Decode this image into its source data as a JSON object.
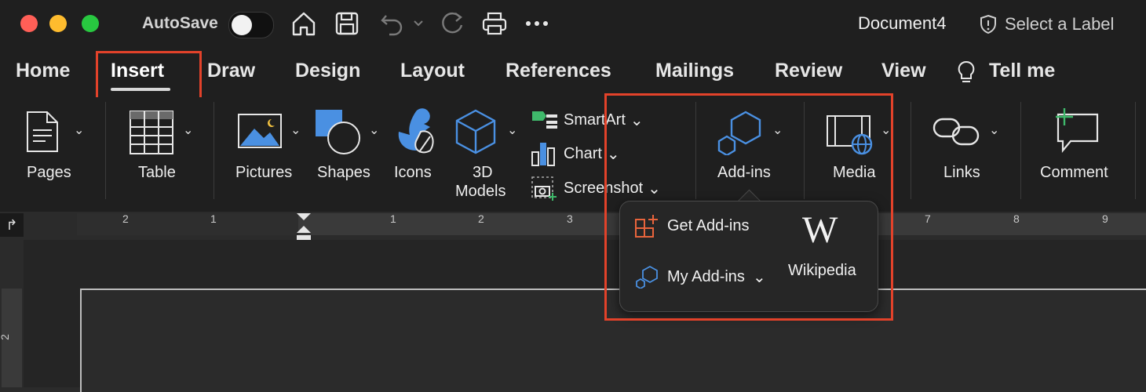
{
  "titlebar": {
    "autosave_label": "AutoSave",
    "document_title": "Document4",
    "label_selector": "Select a Label"
  },
  "tabs": [
    "Home",
    "Insert",
    "Draw",
    "Design",
    "Layout",
    "References",
    "Mailings",
    "Review",
    "View",
    "Tell me"
  ],
  "active_tab": "Insert",
  "ribbon": {
    "pages": "Pages",
    "table": "Table",
    "pictures": "Pictures",
    "shapes": "Shapes",
    "icons": "Icons",
    "models_line1": "3D",
    "models_line2": "Models",
    "smartart": "SmartArt",
    "chart": "Chart",
    "screenshot": "Screenshot",
    "addins": "Add-ins",
    "media": "Media",
    "links": "Links",
    "comment": "Comment"
  },
  "ruler_numbers": [
    "2",
    "1",
    "1",
    "2",
    "3",
    "7",
    "8",
    "9"
  ],
  "vertical_ruler_number": "2",
  "addins_popup": {
    "get_addins": "Get Add-ins",
    "my_addins": "My Add-ins",
    "wikipedia_logo": "W",
    "wikipedia": "Wikipedia"
  },
  "colors": {
    "accent_blue": "#4a90e2",
    "highlight_red": "#e2422a",
    "addin_orange": "#e8643c"
  }
}
